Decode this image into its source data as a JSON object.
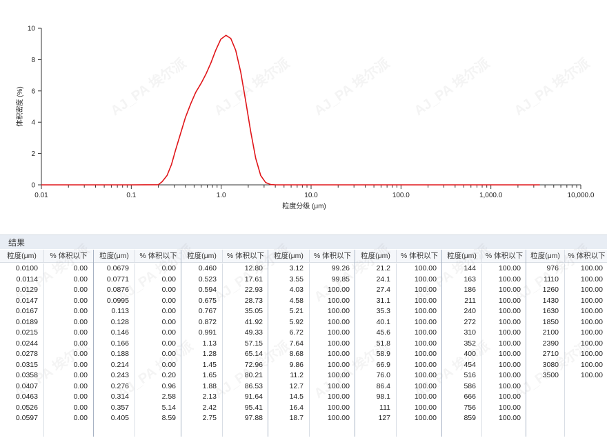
{
  "chart_data": {
    "type": "line",
    "ylabel": "体积密度 (%)",
    "xlabel": "粒度分级 (μm)",
    "xscale": "log",
    "xlim": [
      0.01,
      10000
    ],
    "ylim": [
      0,
      10
    ],
    "x_ticks": [
      "0.01",
      "0.1",
      "1.0",
      "10.0",
      "100.0",
      "1,000.0",
      "10,000.0"
    ],
    "y_ticks": [
      "0",
      "2",
      "4",
      "6",
      "8",
      "10"
    ],
    "line_color": "#e0161a",
    "series": [
      {
        "x": [
          0.01,
          0.1,
          0.2,
          0.22,
          0.25,
          0.28,
          0.31,
          0.35,
          0.4,
          0.46,
          0.52,
          0.6,
          0.68,
          0.77,
          0.87,
          0.99,
          1.13,
          1.28,
          1.45,
          1.65,
          1.88,
          2.13,
          2.42,
          2.75,
          3.12,
          3.55,
          4.03,
          10,
          100,
          1000,
          3500
        ],
        "y": [
          0,
          0,
          0.01,
          0.2,
          0.6,
          1.3,
          2.2,
          3.2,
          4.3,
          5.2,
          5.9,
          6.5,
          7.1,
          7.8,
          8.6,
          9.3,
          9.55,
          9.35,
          8.6,
          7.2,
          5.3,
          3.4,
          1.7,
          0.6,
          0.15,
          0.02,
          0,
          0,
          0,
          0,
          0
        ]
      }
    ]
  },
  "results": {
    "title": "结果",
    "size_header": "粒度(μm)",
    "pct_header": "% 体积以下",
    "groups": [
      {
        "sizes": [
          "0.0100",
          "0.0114",
          "0.0129",
          "0.0147",
          "0.0167",
          "0.0189",
          "0.0215",
          "0.0244",
          "0.0278",
          "0.0315",
          "0.0358",
          "0.0407",
          "0.0463",
          "0.0526",
          "0.0597"
        ],
        "pcts": [
          "0.00",
          "0.00",
          "0.00",
          "0.00",
          "0.00",
          "0.00",
          "0.00",
          "0.00",
          "0.00",
          "0.00",
          "0.00",
          "0.00",
          "0.00",
          "0.00",
          "0.00"
        ]
      },
      {
        "sizes": [
          "0.0679",
          "0.0771",
          "0.0876",
          "0.0995",
          "0.113",
          "0.128",
          "0.146",
          "0.166",
          "0.188",
          "0.214",
          "0.243",
          "0.276",
          "0.314",
          "0.357",
          "0.405"
        ],
        "pcts": [
          "0.00",
          "0.00",
          "0.00",
          "0.00",
          "0.00",
          "0.00",
          "0.00",
          "0.00",
          "0.00",
          "0.00",
          "0.20",
          "0.96",
          "2.58",
          "5.14",
          "8.59"
        ]
      },
      {
        "sizes": [
          "0.460",
          "0.523",
          "0.594",
          "0.675",
          "0.767",
          "0.872",
          "0.991",
          "1.13",
          "1.28",
          "1.45",
          "1.65",
          "1.88",
          "2.13",
          "2.42",
          "2.75"
        ],
        "pcts": [
          "12.80",
          "17.61",
          "22.93",
          "28.73",
          "35.05",
          "41.92",
          "49.33",
          "57.15",
          "65.14",
          "72.96",
          "80.21",
          "86.53",
          "91.64",
          "95.41",
          "97.88"
        ]
      },
      {
        "sizes": [
          "3.12",
          "3.55",
          "4.03",
          "4.58",
          "5.21",
          "5.92",
          "6.72",
          "7.64",
          "8.68",
          "9.86",
          "11.2",
          "12.7",
          "14.5",
          "16.4",
          "18.7"
        ],
        "pcts": [
          "99.26",
          "99.85",
          "100.00",
          "100.00",
          "100.00",
          "100.00",
          "100.00",
          "100.00",
          "100.00",
          "100.00",
          "100.00",
          "100.00",
          "100.00",
          "100.00",
          "100.00"
        ]
      },
      {
        "sizes": [
          "21.2",
          "24.1",
          "27.4",
          "31.1",
          "35.3",
          "40.1",
          "45.6",
          "51.8",
          "58.9",
          "66.9",
          "76.0",
          "86.4",
          "98.1",
          "111",
          "127"
        ],
        "pcts": [
          "100.00",
          "100.00",
          "100.00",
          "100.00",
          "100.00",
          "100.00",
          "100.00",
          "100.00",
          "100.00",
          "100.00",
          "100.00",
          "100.00",
          "100.00",
          "100.00",
          "100.00"
        ]
      },
      {
        "sizes": [
          "144",
          "163",
          "186",
          "211",
          "240",
          "272",
          "310",
          "352",
          "400",
          "454",
          "516",
          "586",
          "666",
          "756",
          "859"
        ],
        "pcts": [
          "100.00",
          "100.00",
          "100.00",
          "100.00",
          "100.00",
          "100.00",
          "100.00",
          "100.00",
          "100.00",
          "100.00",
          "100.00",
          "100.00",
          "100.00",
          "100.00",
          "100.00"
        ]
      },
      {
        "sizes": [
          "976",
          "1110",
          "1260",
          "1430",
          "1630",
          "1850",
          "2100",
          "2390",
          "2710",
          "3080",
          "3500"
        ],
        "pcts": [
          "100.00",
          "100.00",
          "100.00",
          "100.00",
          "100.00",
          "100.00",
          "100.00",
          "100.00",
          "100.00",
          "100.00",
          "100.00"
        ]
      }
    ]
  },
  "watermark": "AJ_PA 埃尔派"
}
